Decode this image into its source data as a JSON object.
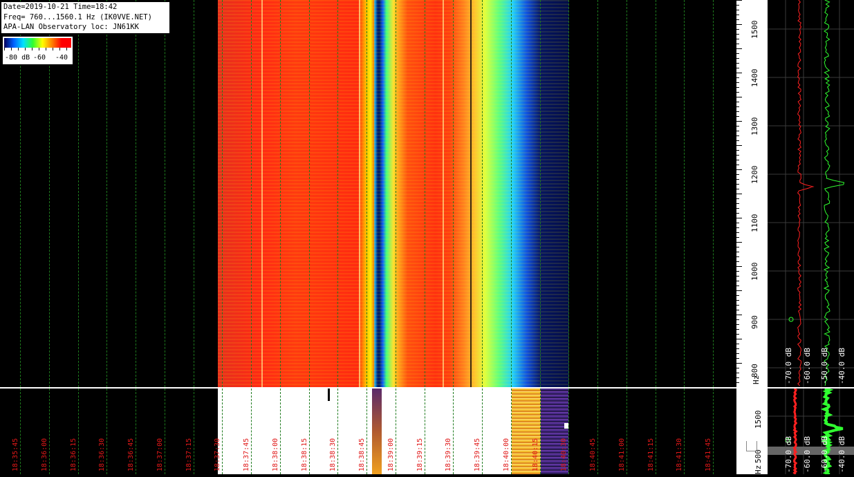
{
  "info": {
    "line1": "Date=2019-10-21 Time=18:42",
    "line2": "Freq= 760...1560.1 Hz (IK0VVE.NET)",
    "line3": "APA-LAN Observatory loc: JN61KK"
  },
  "legend": {
    "label_low": "-80 dB",
    "label_mid": "-60",
    "label_high": "-40"
  },
  "freq_axis": {
    "ticks": [
      "1500",
      "1400",
      "1300",
      "1200",
      "1100",
      "1000",
      "900",
      "800"
    ],
    "unit": "Hz"
  },
  "spectrum_labels": {
    "red_left": "-70.0 dB",
    "red_right": "-60.0 dB",
    "green_left": "-50.0 dB",
    "green_right": "-40.0 dB"
  },
  "lower_axis": {
    "tick_high": "1500",
    "tick_low": "500",
    "unit": "Hz"
  },
  "lower_spectrum_labels": {
    "red_left": "-70.0 dB",
    "red_right": "-60.0 dB",
    "green_left": "-60.0 dB",
    "green_right": "-40.0 dB"
  },
  "time_labels": [
    "18:35:45",
    "18:36:00",
    "18:36:15",
    "18:36:30",
    "18:36:45",
    "18:37:00",
    "18:37:15",
    "18:37:30",
    "18:37:45",
    "18:38:00",
    "18:38:15",
    "18:38:30",
    "18:38:45",
    "18:39:00",
    "18:39:15",
    "18:39:30",
    "18:39:45",
    "18:40:00",
    "18:40:15",
    "18:40:30",
    "18:40:45",
    "18:41:00",
    "18:41:15",
    "18:41:30",
    "18:41:45"
  ],
  "colors": {
    "grid": "#1d7a1d",
    "time_label": "#e01818",
    "spectrum_red": "#ff2020",
    "spectrum_green": "#30ff30"
  }
}
